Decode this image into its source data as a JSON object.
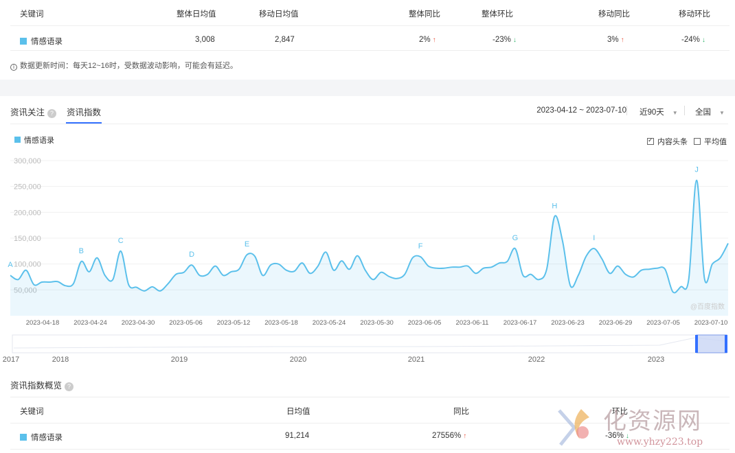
{
  "top_table": {
    "headers": [
      "关键词",
      "整体日均值",
      "移动日均值",
      "整体同比",
      "整体环比",
      "移动同比",
      "移动环比"
    ],
    "row": {
      "keyword": "情感语录",
      "overall_avg": "3,008",
      "mobile_avg": "2,847",
      "overall_yoy": "2%",
      "overall_yoy_dir": "up",
      "overall_qoq": "-23%",
      "overall_qoq_dir": "down",
      "mobile_yoy": "3%",
      "mobile_yoy_dir": "up",
      "mobile_qoq": "-24%",
      "mobile_qoq_dir": "down"
    }
  },
  "note": "数据更新时间：每天12~16时，受数据波动影响，可能会有延迟。",
  "tabs": {
    "tab1": "资讯关注",
    "tab2": "资讯指数"
  },
  "filters": {
    "date_range": "2023-04-12 ~ 2023-07-10",
    "period": "近90天",
    "region": "全国"
  },
  "legend": {
    "series": "情感语录"
  },
  "options": {
    "opt1": "内容头条",
    "opt2": "平均值"
  },
  "watermark_chart": "@百度指数",
  "colors": {
    "series": "#5bc0eb",
    "accent": "#3370ff",
    "up": "#e8543f",
    "down": "#2fb16b"
  },
  "chart_data": {
    "type": "area",
    "series_name": "情感语录",
    "ylim": [
      0,
      300000
    ],
    "y_ticks": [
      "300,000",
      "250,000",
      "200,000",
      "150,000",
      "100,000",
      "50,000"
    ],
    "x_ticks": [
      "2023-04-18",
      "2023-04-24",
      "2023-04-30",
      "2023-05-06",
      "2023-05-12",
      "2023-05-18",
      "2023-05-24",
      "2023-05-30",
      "2023-06-05",
      "2023-06-11",
      "2023-06-17",
      "2023-06-23",
      "2023-06-29",
      "2023-07-05",
      "2023-07-10"
    ],
    "x_start": "2023-04-12",
    "values": [
      78000,
      70000,
      88000,
      60000,
      65000,
      65000,
      66000,
      58000,
      62000,
      105000,
      85000,
      112000,
      78000,
      70000,
      125000,
      60000,
      55000,
      48000,
      56000,
      48000,
      62000,
      80000,
      84000,
      98000,
      78000,
      80000,
      96000,
      78000,
      85000,
      90000,
      118000,
      115000,
      78000,
      98000,
      100000,
      88000,
      86000,
      102000,
      82000,
      96000,
      123000,
      88000,
      106000,
      90000,
      116000,
      88000,
      70000,
      84000,
      76000,
      72000,
      80000,
      112000,
      114000,
      96000,
      92000,
      92000,
      94000,
      94000,
      96000,
      82000,
      92000,
      94000,
      102000,
      105000,
      130000,
      78000,
      80000,
      70000,
      90000,
      192000,
      145000,
      58000,
      78000,
      115000,
      130000,
      110000,
      82000,
      96000,
      80000,
      75000,
      88000,
      90000,
      92000,
      90000,
      46000,
      56000,
      70000,
      262000,
      72000,
      100000,
      112000,
      140000
    ],
    "annotations": [
      {
        "label": "A",
        "index": 0
      },
      {
        "label": "B",
        "index": 9
      },
      {
        "label": "C",
        "index": 14
      },
      {
        "label": "D",
        "index": 23
      },
      {
        "label": "E",
        "index": 30
      },
      {
        "label": "F",
        "index": 52
      },
      {
        "label": "G",
        "index": 64
      },
      {
        "label": "H",
        "index": 69
      },
      {
        "label": "I",
        "index": 74
      },
      {
        "label": "J",
        "index": 87
      }
    ],
    "navigator_years": [
      "2017",
      "2018",
      "2019",
      "2020",
      "2021",
      "2022",
      "2023"
    ]
  },
  "overview": {
    "title": "资讯指数概览",
    "headers": [
      "关键词",
      "日均值",
      "同比",
      "环比"
    ],
    "row": {
      "keyword": "情感语录",
      "avg": "91,214",
      "yoy": "27556%",
      "yoy_dir": "up",
      "qoq": "-36%",
      "qoq_dir": "down"
    }
  },
  "site_watermark": {
    "text": "化资源网",
    "url": "www.yhzy223.top"
  }
}
